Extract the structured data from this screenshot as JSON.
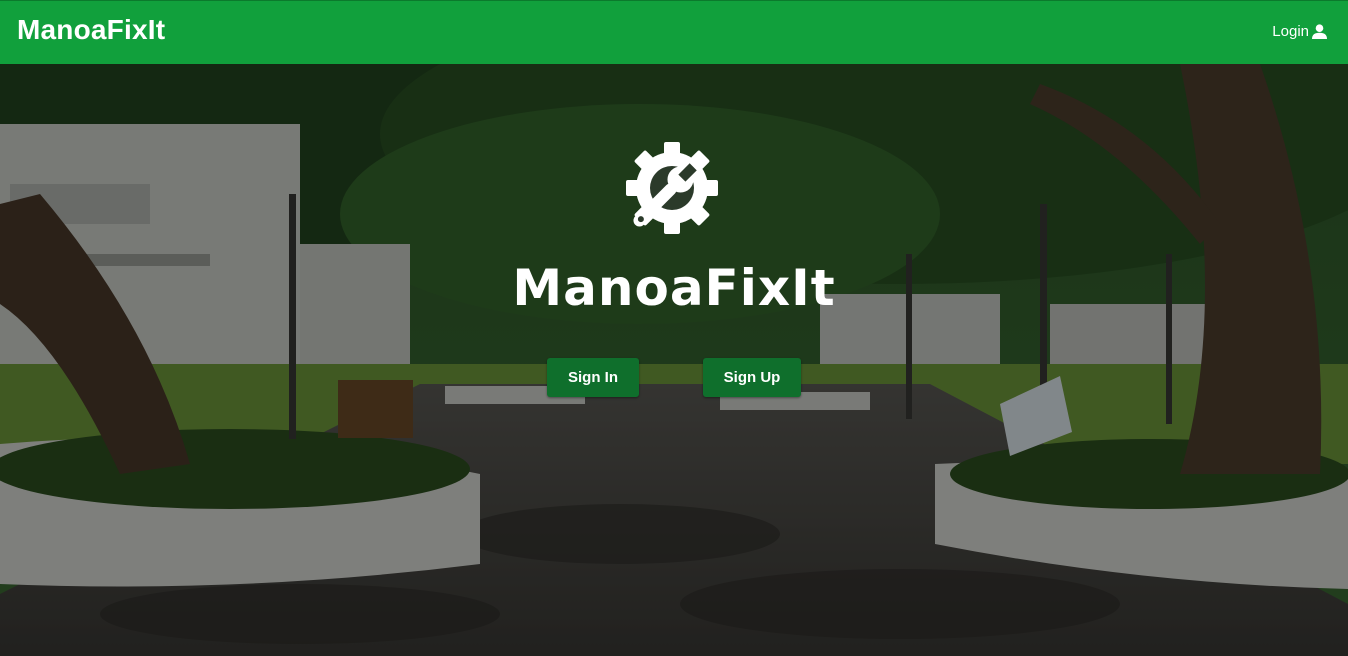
{
  "navbar": {
    "brand": "ManoaFixIt",
    "login_label": "Login",
    "login_icon": "user-icon",
    "background_color": "#11a03c"
  },
  "hero": {
    "background": "campus-walkway-photo",
    "logo_icon": "gear-wrench-icon",
    "logo_text": "ManoaFixIt",
    "sign_in_label": "Sign In",
    "sign_up_label": "Sign Up",
    "button_color": "#0f6f2c"
  }
}
